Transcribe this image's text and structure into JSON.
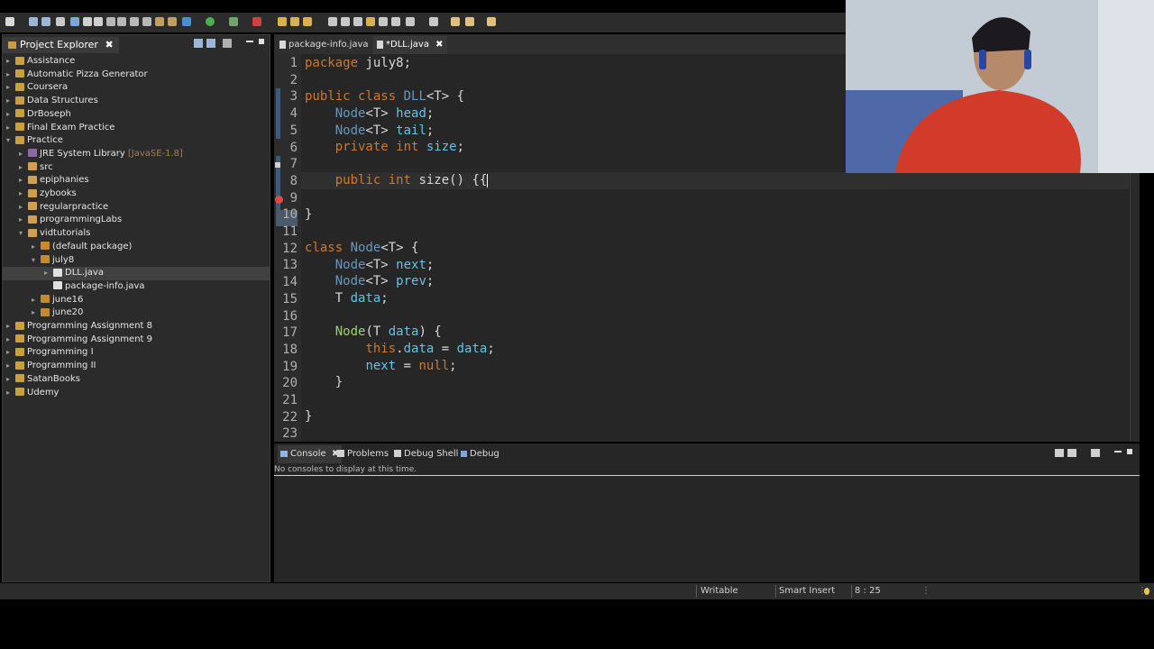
{
  "explorer": {
    "tab_label": "Project Explorer",
    "items": [
      {
        "label": "Assistance"
      },
      {
        "label": "Automatic Pizza Generator"
      },
      {
        "label": "Coursera"
      },
      {
        "label": "Data Structures"
      },
      {
        "label": "DrBoseph"
      },
      {
        "label": "Final Exam Practice"
      },
      {
        "label": "Practice"
      },
      {
        "label": "JRE System Library",
        "decoration": "[JavaSE-1.8]"
      },
      {
        "label": "src"
      },
      {
        "label": "epiphanies"
      },
      {
        "label": "zybooks"
      },
      {
        "label": "regularpractice"
      },
      {
        "label": "programmingLabs"
      },
      {
        "label": "vidtutorials"
      },
      {
        "label": "(default package)"
      },
      {
        "label": "july8"
      },
      {
        "label": "DLL.java"
      },
      {
        "label": "package-info.java"
      },
      {
        "label": "june16"
      },
      {
        "label": "june20"
      },
      {
        "label": "Programming Assignment 8"
      },
      {
        "label": "Programming Assignment 9"
      },
      {
        "label": "Programming I"
      },
      {
        "label": "Programming II"
      },
      {
        "label": "SatanBooks"
      },
      {
        "label": "Udemy"
      }
    ]
  },
  "editor": {
    "tabs": [
      {
        "label": "package-info.java"
      },
      {
        "label": "*DLL.java"
      }
    ],
    "line_numbers": [
      "1",
      "2",
      "3",
      "4",
      "5",
      "6",
      "7",
      "8",
      "9",
      "10",
      "11",
      "12",
      "13",
      "14",
      "15",
      "16",
      "17",
      "18",
      "19",
      "20",
      "21",
      "22",
      "23"
    ],
    "code": {
      "l1_kw": "package",
      "l1_rest": " july8;",
      "l3_kw": "public class",
      "l3_name": "DLL",
      "l3_rest": "<T> {",
      "l4_type": "Node",
      "l4_gen": "<T> ",
      "l4_field": "head",
      "l4_end": ";",
      "l5_type": "Node",
      "l5_gen": "<T> ",
      "l5_field": "tail",
      "l5_end": ";",
      "l6_kw": "private int",
      "l6_field": "size",
      "l6_end": ";",
      "l8_kw": "public int",
      "l8_rest": " size() {{",
      "l10": "}",
      "l12_kw": "class",
      "l12_name": "Node",
      "l12_rest": "<T> {",
      "l13_type": "Node",
      "l13_gen": "<T> ",
      "l13_field": "next",
      "l13_end": ";",
      "l14_type": "Node",
      "l14_gen": "<T> ",
      "l14_field": "prev",
      "l14_end": ";",
      "l15_t": "T ",
      "l15_field": "data",
      "l15_end": ";",
      "l17_fn": "Node",
      "l17_a": "(T ",
      "l17_param": "data",
      "l17_b": ") {",
      "l18_kw": "this",
      "l18_dot": ".",
      "l18_field": "data",
      "l18_eq": " = ",
      "l18_param": "data",
      "l18_end": ";",
      "l19_field": "next",
      "l19_eq": " = ",
      "l19_null": "null",
      "l19_end": ";",
      "l20": "}",
      "l22": "}"
    }
  },
  "console": {
    "tabs": [
      {
        "label": "Console"
      },
      {
        "label": "Problems"
      },
      {
        "label": "Debug Shell"
      },
      {
        "label": "Debug"
      }
    ],
    "message": "No consoles to display at this time."
  },
  "status": {
    "mode": "Writable",
    "insert": "Smart Insert",
    "position": "8 : 25"
  },
  "colors": {
    "keyword": "#cc7832",
    "type": "#6897bb",
    "field": "#66c3e0",
    "method": "#9cd36f",
    "background": "#262626"
  }
}
